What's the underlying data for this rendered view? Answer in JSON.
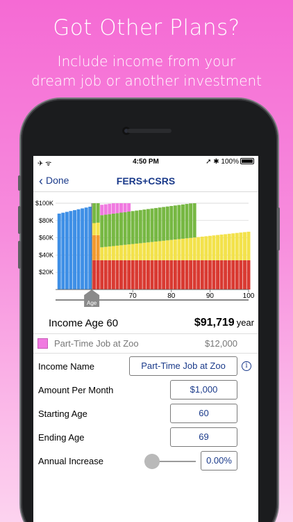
{
  "promo": {
    "title": "Got Other Plans?",
    "subtitle_line1": "Include income from your",
    "subtitle_line2": "dream job or another investment"
  },
  "status_bar": {
    "left": "✈ ᯤ",
    "time": "4:50 PM",
    "right": "➚ ✱ 100%"
  },
  "nav": {
    "back_label": "Done",
    "title": "FERS+CSRS"
  },
  "chart_data": {
    "type": "bar",
    "stacked": true,
    "y_tick_labels": [
      "$100K",
      "$80K",
      "$60K",
      "$40K",
      "$20K"
    ],
    "y_ticks": [
      100000,
      80000,
      60000,
      40000,
      20000
    ],
    "x_tick_labels": [
      "70",
      "80",
      "90",
      "100"
    ],
    "x_ticks": [
      70,
      80,
      90,
      100
    ],
    "xlim": [
      50,
      100
    ],
    "ylim": [
      0,
      100000
    ],
    "grid": true,
    "marker": {
      "age": 60,
      "label": "Age"
    },
    "colors": {
      "blue": "#3e8fe6",
      "red": "#d93a32",
      "orange": "#f29a2e",
      "yellow": "#f3e24b",
      "green": "#77b843",
      "pink": "#f07ae0"
    },
    "series": [
      {
        "name": "",
        "color": "#3e8fe6",
        "x": [
          51,
          52,
          53,
          54,
          55,
          56,
          57,
          58,
          59
        ],
        "values": [
          88000,
          89000,
          90000,
          91000,
          92000,
          93000,
          94000,
          95000,
          96000
        ]
      },
      {
        "name": "",
        "color": "#d93a32",
        "x_range": [
          60,
          100
        ],
        "values_start": 34000,
        "values_end": 34000
      },
      {
        "name": "",
        "color": "#f29a2e",
        "x_range": [
          60,
          61
        ],
        "values_start": 29000,
        "values_end": 29000
      },
      {
        "name": "",
        "color": "#f3e24b",
        "x_range": [
          60,
          100
        ],
        "values_start": 14000,
        "values_end": 33000
      },
      {
        "name": "",
        "color": "#77b843",
        "x_range": [
          60,
          86
        ],
        "values_start": 37000,
        "values_end": 40000
      },
      {
        "name": "",
        "color": "#f07ae0",
        "x_range": [
          62,
          69
        ],
        "values_start": 12000,
        "values_end": 12000
      }
    ]
  },
  "income": {
    "label": "Income Age 60",
    "value": "$91,719",
    "unit": "year"
  },
  "job": {
    "name": "Part-Time Job at Zoo",
    "amount": "$12,000"
  },
  "form": {
    "income_name_label": "Income Name",
    "income_name_value": "Part-Time Job at Zoo",
    "amount_label": "Amount Per Month",
    "amount_value": "$1,000",
    "start_label": "Starting Age",
    "start_value": "60",
    "end_label": "Ending Age",
    "end_value": "69",
    "increase_label": "Annual Increase",
    "increase_value": "0.00%",
    "info_icon": "i"
  }
}
